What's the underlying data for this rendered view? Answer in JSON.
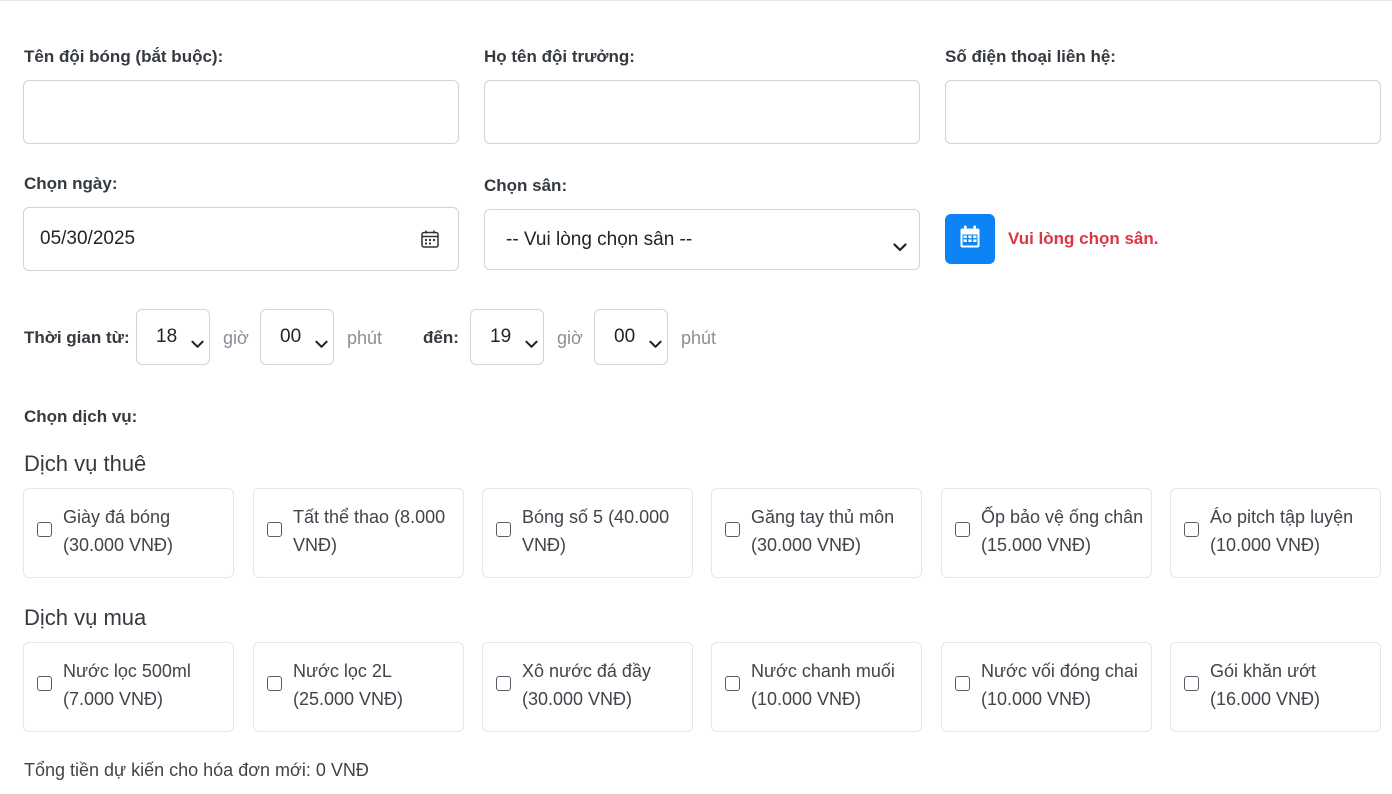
{
  "form": {
    "team_name_label": "Tên đội bóng (bắt buộc):",
    "team_name_value": "",
    "captain_label": "Họ tên đội trưởng:",
    "captain_value": "",
    "phone_label": "Số điện thoại liên hệ:",
    "phone_value": "",
    "date_label": "Chọn ngày:",
    "date_value": "05/30/2025",
    "field_label": "Chọn sân:",
    "field_selected": "-- Vui lòng chọn sân --",
    "field_error": "Vui lòng chọn sân."
  },
  "time": {
    "from_label": "Thời gian từ:",
    "to_label": "đến:",
    "hour_unit": "giờ",
    "minute_unit": "phút",
    "from_hour": "18",
    "from_minute": "00",
    "to_hour": "19",
    "to_minute": "00"
  },
  "services": {
    "label": "Chọn dịch vụ:",
    "rent_title": "Dịch vụ thuê",
    "buy_title": "Dịch vụ mua",
    "rent": [
      {
        "label": "Giày đá bóng (30.000 VNĐ)"
      },
      {
        "label": "Tất thể thao (8.000 VNĐ)"
      },
      {
        "label": "Bóng số 5 (40.000 VNĐ)"
      },
      {
        "label": "Găng tay thủ môn (30.000 VNĐ)"
      },
      {
        "label": "Ốp bảo vệ ống chân (15.000 VNĐ)"
      },
      {
        "label": "Áo pitch tập luyện (10.000 VNĐ)"
      }
    ],
    "buy": [
      {
        "label": "Nước lọc 500ml (7.000 VNĐ)"
      },
      {
        "label": "Nước lọc 2L (25.000 VNĐ)"
      },
      {
        "label": "Xô nước đá đầy (30.000 VNĐ)"
      },
      {
        "label": "Nước chanh muối (10.000 VNĐ)"
      },
      {
        "label": "Nước vối đóng chai (10.000 VNĐ)"
      },
      {
        "label": "Gói khăn ướt (16.000 VNĐ)"
      }
    ]
  },
  "total_text": "Tổng tiền dự kiến cho hóa đơn mới: 0 VNĐ",
  "colors": {
    "accent": "#0d84f6",
    "error": "#dc3545",
    "border": "#ced4da"
  }
}
